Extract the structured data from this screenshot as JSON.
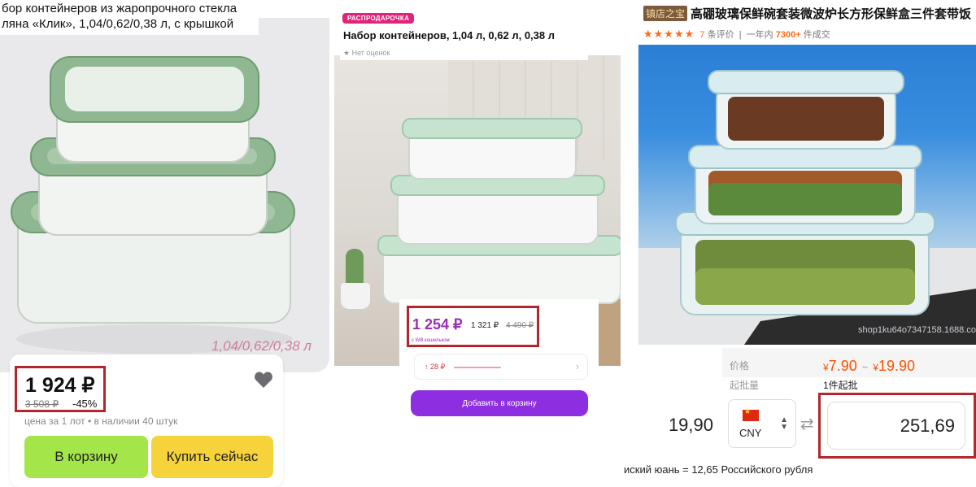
{
  "panel1": {
    "title": "бор контейнеров из жаропрочного стекла ляна «Клик», 1,04/0,62/0,38 л, с крышкой",
    "photo_volume": "1,04/0,62/0,38 л",
    "price": "1 924 ₽",
    "old_price": "3 508 ₽",
    "discount": "-45%",
    "info": "цена за 1 лот • в наличии 40 штук",
    "cart_button": "В корзину",
    "buy_button": "Купить сейчас",
    "icons": {
      "favorite": "heart-icon"
    },
    "colors": {
      "cart_button": "#a4e64a",
      "buy_button": "#f6d33b",
      "volume_text": "#d07b98",
      "highlight": "#b3262b"
    }
  },
  "panel2": {
    "sale_badge": "РАСПРОДАРОЧКА",
    "title": "Набор контейнеров, 1,04 л, 0,62 л, 0,38 л",
    "rating": "★ Нет оценок",
    "price": "1 254 ₽",
    "price_secondary": "1 321 ₽",
    "old_price": "4 490 ₽",
    "wallet_note": "с WB кошельком",
    "bonus": "↑ 28 ₽",
    "cart_button": "Добавить в корзину",
    "icons": {
      "chevron": "chevron-right-icon"
    },
    "colors": {
      "accent": "#9b2fb7",
      "button": "#8d2fe0",
      "badge": "#e2237a",
      "highlight": "#b3262b"
    }
  },
  "panel3": {
    "shop_badge": "镇店之宝",
    "title": "高硼玻璃保鲜碗套装微波炉长方形保鲜盒三件套带饭",
    "stars": "★★★★★",
    "reviews_count": "7",
    "reviews_label": "条评价",
    "sales_prefix": "一年内",
    "sales_count": "7300+",
    "sales_suffix": "件成交",
    "watermark": "shop1ku64o7347158.1688.com",
    "price_label": "价格",
    "price_low": "7.90",
    "price_high": "19.90",
    "currency_symbol": "¥",
    "price_separator": "~",
    "moq_label": "起批量",
    "moq_value": "1件起批",
    "source_amount": "19,90",
    "currency_code": "CNY",
    "result_amount": "251,69",
    "rate_text": "иский юань = 12,65 Российского рубля",
    "icons": {
      "flag": "china-flag-icon",
      "swap": "swap-arrows-icon",
      "select": "up-down-arrows-icon"
    },
    "colors": {
      "price": "#ff5000",
      "stars": "#ff6a1a",
      "highlight": "#b3262b"
    }
  }
}
